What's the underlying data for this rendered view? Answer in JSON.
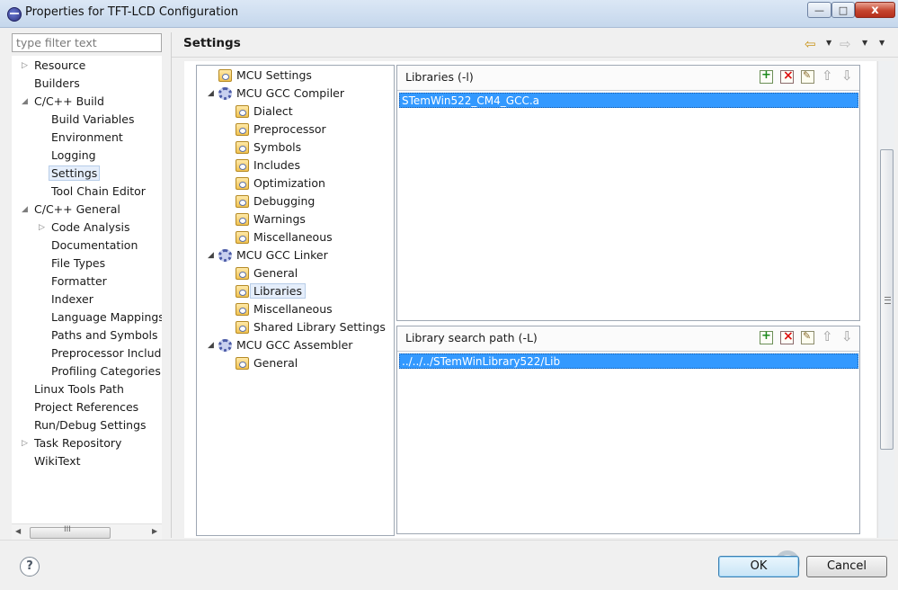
{
  "window": {
    "title": "Properties for TFT-LCD Configuration",
    "minimize_glyph": "—",
    "maximize_glyph": "□",
    "close_glyph": "x"
  },
  "filter": {
    "placeholder": "type filter text"
  },
  "nav_tree": [
    {
      "label": "Resource",
      "expander": "▷"
    },
    {
      "label": "Builders",
      "expander": ""
    },
    {
      "label": "C/C++ Build",
      "expander": "◢"
    },
    {
      "label": "Build Variables",
      "expander": ""
    },
    {
      "label": "Environment",
      "expander": ""
    },
    {
      "label": "Logging",
      "expander": ""
    },
    {
      "label": "Settings",
      "expander": "",
      "selected": true
    },
    {
      "label": "Tool Chain Editor",
      "expander": ""
    },
    {
      "label": "C/C++ General",
      "expander": "◢"
    },
    {
      "label": "Code Analysis",
      "expander": "▷"
    },
    {
      "label": "Documentation",
      "expander": ""
    },
    {
      "label": "File Types",
      "expander": ""
    },
    {
      "label": "Formatter",
      "expander": ""
    },
    {
      "label": "Indexer",
      "expander": ""
    },
    {
      "label": "Language Mappings",
      "expander": ""
    },
    {
      "label": "Paths and Symbols",
      "expander": ""
    },
    {
      "label": "Preprocessor Include",
      "expander": ""
    },
    {
      "label": "Profiling Categories",
      "expander": ""
    },
    {
      "label": "Linux Tools Path",
      "expander": ""
    },
    {
      "label": "Project References",
      "expander": ""
    },
    {
      "label": "Run/Debug Settings",
      "expander": ""
    },
    {
      "label": "Task Repository",
      "expander": "▷"
    },
    {
      "label": "WikiText",
      "expander": ""
    }
  ],
  "nav_scroll": {
    "left_glyph": "◀",
    "right_glyph": "▶",
    "grip": "III"
  },
  "header": {
    "title": "Settings",
    "back_glyph": "⇦",
    "forward_glyph": "⇨",
    "dropdown_glyph": "▼"
  },
  "tool_tree": [
    {
      "label": "MCU Settings",
      "icon": "folder",
      "expander": ""
    },
    {
      "label": "MCU GCC Compiler",
      "icon": "gear",
      "expander": "◢"
    },
    {
      "label": "Dialect",
      "icon": "folder",
      "expander": ""
    },
    {
      "label": "Preprocessor",
      "icon": "folder",
      "expander": ""
    },
    {
      "label": "Symbols",
      "icon": "folder",
      "expander": ""
    },
    {
      "label": "Includes",
      "icon": "folder",
      "expander": ""
    },
    {
      "label": "Optimization",
      "icon": "folder",
      "expander": ""
    },
    {
      "label": "Debugging",
      "icon": "folder",
      "expander": ""
    },
    {
      "label": "Warnings",
      "icon": "folder",
      "expander": ""
    },
    {
      "label": "Miscellaneous",
      "icon": "folder",
      "expander": ""
    },
    {
      "label": "MCU GCC Linker",
      "icon": "gear",
      "expander": "◢"
    },
    {
      "label": "General",
      "icon": "folder",
      "expander": ""
    },
    {
      "label": "Libraries",
      "icon": "folder",
      "expander": "",
      "selected": true
    },
    {
      "label": "Miscellaneous",
      "icon": "folder",
      "expander": ""
    },
    {
      "label": "Shared Library Settings",
      "icon": "folder",
      "expander": ""
    },
    {
      "label": "MCU GCC Assembler",
      "icon": "gear",
      "expander": "◢"
    },
    {
      "label": "General",
      "icon": "folder",
      "expander": ""
    }
  ],
  "libraries": {
    "title": "Libraries (-l)",
    "items": [
      "STemWin522_CM4_GCC.a"
    ]
  },
  "library_paths": {
    "title": "Library search path (-L)",
    "items": [
      "../../../STemWinLibrary522/Lib"
    ]
  },
  "footer": {
    "help_glyph": "?",
    "ok_label": "OK",
    "cancel_label": "Cancel"
  }
}
